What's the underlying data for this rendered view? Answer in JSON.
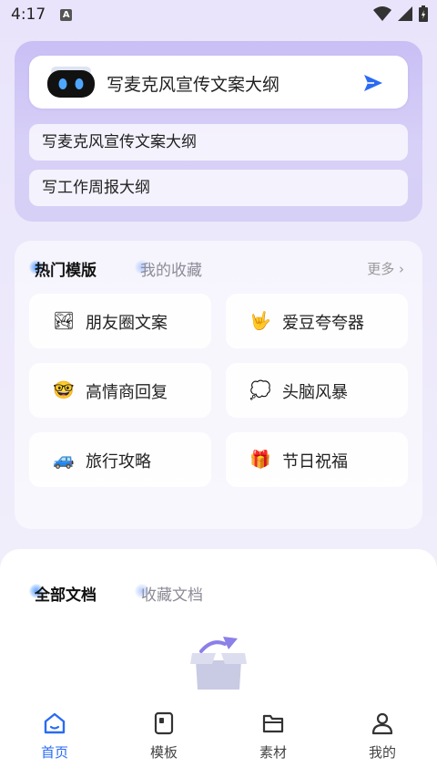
{
  "status_bar": {
    "time": "4:17",
    "notif_letter": "A"
  },
  "ai_box": {
    "prompt": "写麦克风宣传文案大纲",
    "suggestions": [
      "写麦克风宣传文案大纲",
      "写工作周报大纲"
    ]
  },
  "templates": {
    "tab_hot": "热门模版",
    "tab_fav": "我的收藏",
    "more": "更多 ›",
    "items": [
      {
        "icon": "landscape-photo-icon",
        "glyph": "🏞",
        "label": "朋友圈文案"
      },
      {
        "icon": "rock-hand-icon",
        "glyph": "🤟",
        "label": "爱豆夸夸器"
      },
      {
        "icon": "nerd-face-icon",
        "glyph": "🤓",
        "label": "高情商回复"
      },
      {
        "icon": "thought-bubble-icon",
        "glyph": "💭",
        "label": "头脑风暴"
      },
      {
        "icon": "car-icon",
        "glyph": "🚙",
        "label": "旅行攻略"
      },
      {
        "icon": "gift-icon",
        "glyph": "🎁",
        "label": "节日祝福"
      }
    ]
  },
  "documents": {
    "tab_all": "全部文档",
    "tab_fav": "收藏文档"
  },
  "bottom_nav": [
    {
      "label": "首页",
      "icon": "home-icon",
      "active": true
    },
    {
      "label": "模板",
      "icon": "template-icon",
      "active": false
    },
    {
      "label": "素材",
      "icon": "folder-icon",
      "active": false
    },
    {
      "label": "我的",
      "icon": "profile-icon",
      "active": false
    }
  ],
  "colors": {
    "accent": "#2a6bf2",
    "card_purple": "#cfc6f6"
  }
}
